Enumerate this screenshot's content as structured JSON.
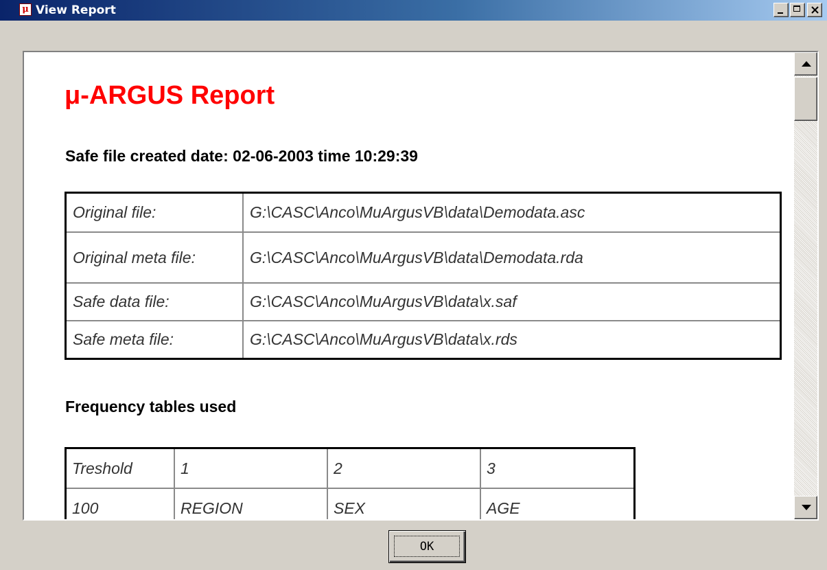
{
  "window": {
    "title": "View Report",
    "app_icon_glyph": "μ"
  },
  "report": {
    "title": "μ-ARGUS Report",
    "created_line": "Safe file created date: 02-06-2003 time 10:29:39",
    "files": [
      {
        "label": "Original file:",
        "value": "G:\\CASC\\Anco\\MuArgusVB\\data\\Demodata.asc"
      },
      {
        "label": "Original meta file:",
        "value": "G:\\CASC\\Anco\\MuArgusVB\\data\\Demodata.rda"
      },
      {
        "label": "Safe data file:",
        "value": "G:\\CASC\\Anco\\MuArgusVB\\data\\x.saf"
      },
      {
        "label": "Safe meta file:",
        "value": "G:\\CASC\\Anco\\MuArgusVB\\data\\x.rds"
      }
    ],
    "freq_heading": "Frequency tables used",
    "freq_table": {
      "header": [
        "Treshold",
        "1",
        "2",
        "3"
      ],
      "rows": [
        [
          "100",
          "REGION",
          "SEX",
          "AGE"
        ]
      ]
    }
  },
  "buttons": {
    "ok_label": "OK"
  },
  "colors": {
    "title_red": "#ff0000",
    "titlebar_dark": "#0a246a",
    "titlebar_light": "#a6caf0",
    "dialog_face": "#d4d0c8"
  }
}
